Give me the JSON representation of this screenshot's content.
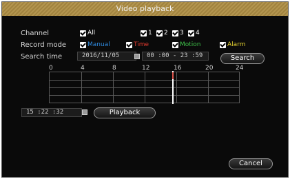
{
  "window": {
    "title": "Video playback"
  },
  "channel": {
    "label": "Channel",
    "all_label": "All",
    "items": [
      "1",
      "2",
      "3",
      "4"
    ]
  },
  "record_mode": {
    "label": "Record mode",
    "manual": "Manual",
    "time": "Time",
    "motion": "Motion",
    "alarm": "Alarm",
    "colors": {
      "manual": "#2f8be0",
      "time": "#e03a2e",
      "motion": "#3fc34a",
      "alarm": "#e6d232"
    }
  },
  "search": {
    "label": "Search time",
    "date": "2016/11/05",
    "time_range": "00 :00 - 23 :59",
    "button": "Search"
  },
  "timeline": {
    "ticks": [
      "0",
      "4",
      "8",
      "12",
      "16",
      "20",
      "24"
    ],
    "current_hour": 15.5
  },
  "playback": {
    "time": "15 :22 :32",
    "button": "Playback"
  },
  "cancel_button": "Cancel"
}
